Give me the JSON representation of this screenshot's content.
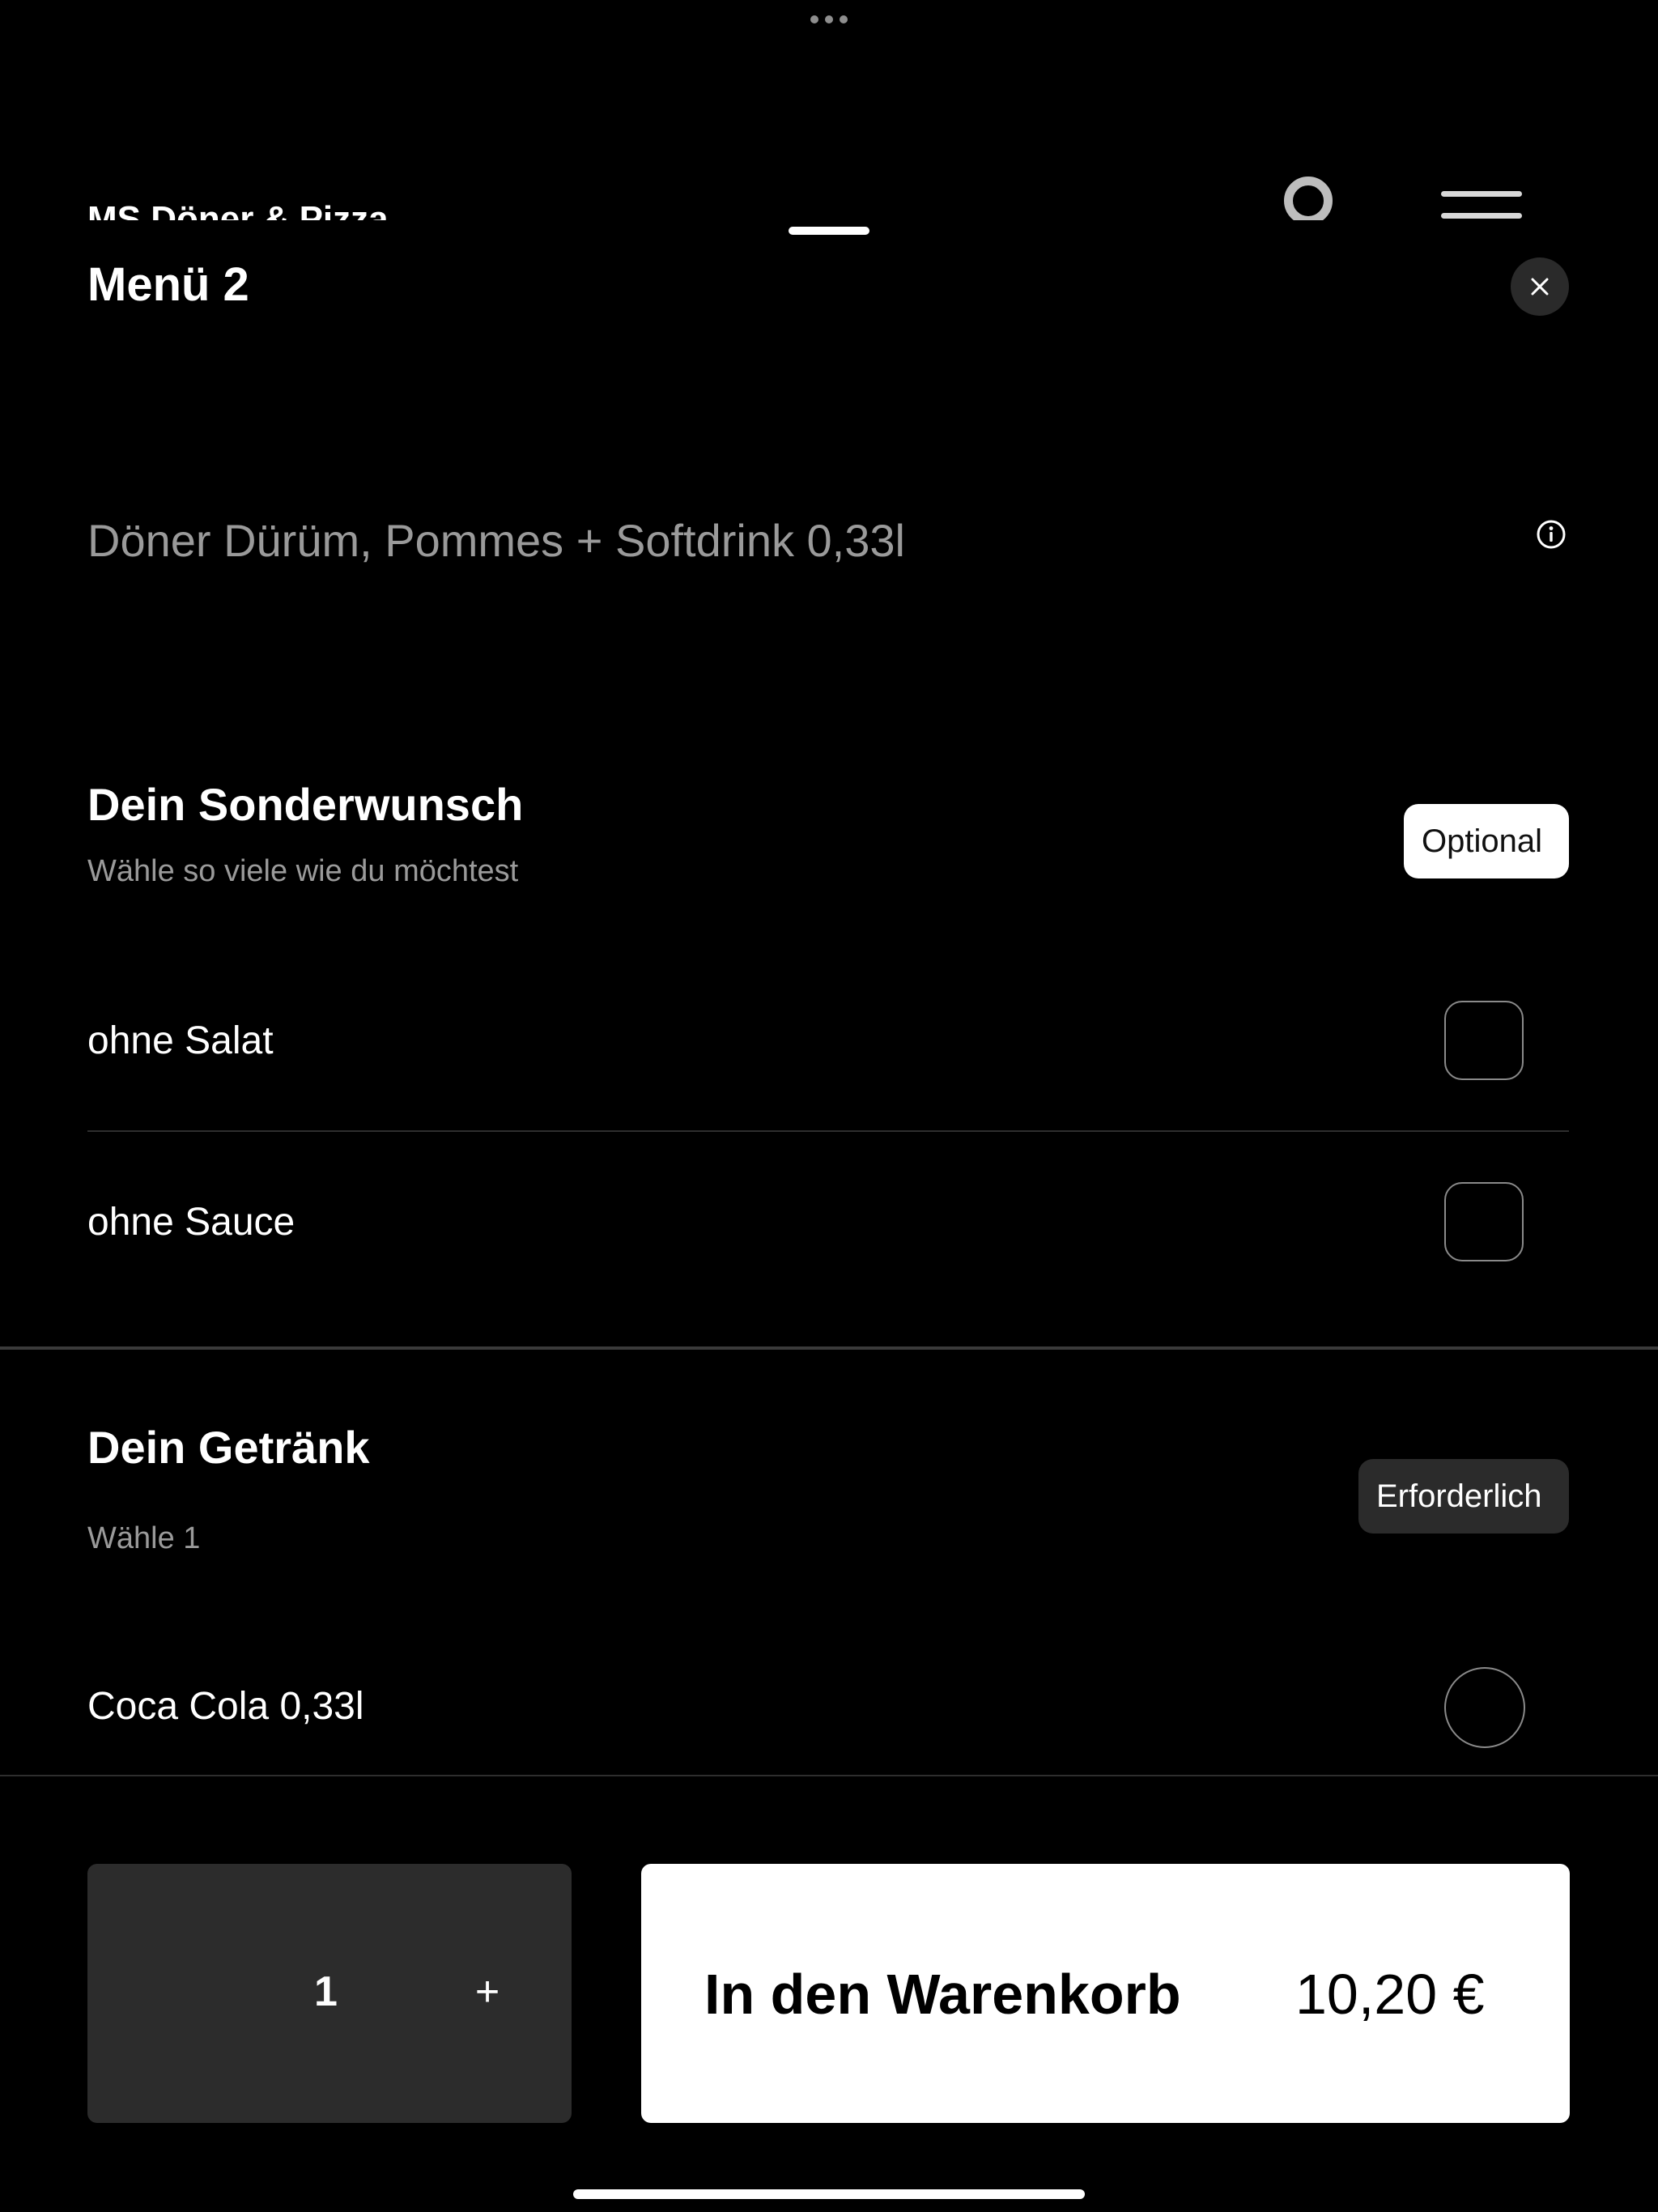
{
  "background_header": {
    "title": "MS Döner & Pizza"
  },
  "sheet": {
    "title": "Menü 2",
    "description": "Döner Dürüm, Pommes + Softdrink 0,33l"
  },
  "sections": [
    {
      "title": "Dein Sonderwunsch",
      "subtitle": "Wähle so viele wie du möchtest",
      "badge": "Optional",
      "options": [
        {
          "label": "ohne Salat"
        },
        {
          "label": "ohne Sauce"
        }
      ]
    },
    {
      "title": "Dein Getränk",
      "subtitle": "Wähle 1",
      "badge": "Erforderlich",
      "options": [
        {
          "label": "Coca Cola 0,33l"
        }
      ]
    }
  ],
  "bottom_bar": {
    "quantity": "1",
    "plus_label": "+",
    "cart_label": "In den Warenkorb",
    "price": "10,20 €"
  },
  "icons": {
    "close": "close-icon",
    "info": "info-icon"
  },
  "colors": {
    "background": "#000000",
    "stepper": "#2c2c2c",
    "badge_required": "#2b2b2b",
    "secondary_text": "#9a9a9a"
  }
}
